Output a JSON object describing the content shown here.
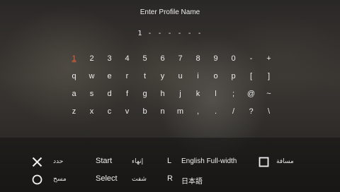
{
  "title": "Enter Profile Name",
  "name_field": {
    "value": "1 - - - - - -"
  },
  "keyboard": {
    "rows": [
      [
        "1",
        "2",
        "3",
        "4",
        "5",
        "6",
        "7",
        "8",
        "9",
        "0",
        "-",
        "+"
      ],
      [
        "q",
        "w",
        "e",
        "r",
        "t",
        "y",
        "u",
        "i",
        "o",
        "p",
        "[",
        "]"
      ],
      [
        "a",
        "s",
        "d",
        "f",
        "g",
        "h",
        "j",
        "k",
        "l",
        ";",
        "@",
        "~"
      ],
      [
        "z",
        "x",
        "c",
        "v",
        "b",
        "n",
        "m",
        ",",
        ".",
        "/",
        "?",
        "\\"
      ]
    ],
    "selected": "1"
  },
  "hints": {
    "cross_label": "حدد",
    "circle_label": "مسح",
    "start": "Start",
    "start_label": "إنهاء",
    "select": "Select",
    "select_label": "شفت",
    "l": "L",
    "l_label": "English Full-width",
    "r": "R",
    "r_label": "日本語",
    "square_label": "مسافة"
  },
  "colors": {
    "accent": "#e8633c",
    "text": "#eeeeee"
  },
  "icons": [
    "cross-icon",
    "circle-icon",
    "square-icon"
  ]
}
